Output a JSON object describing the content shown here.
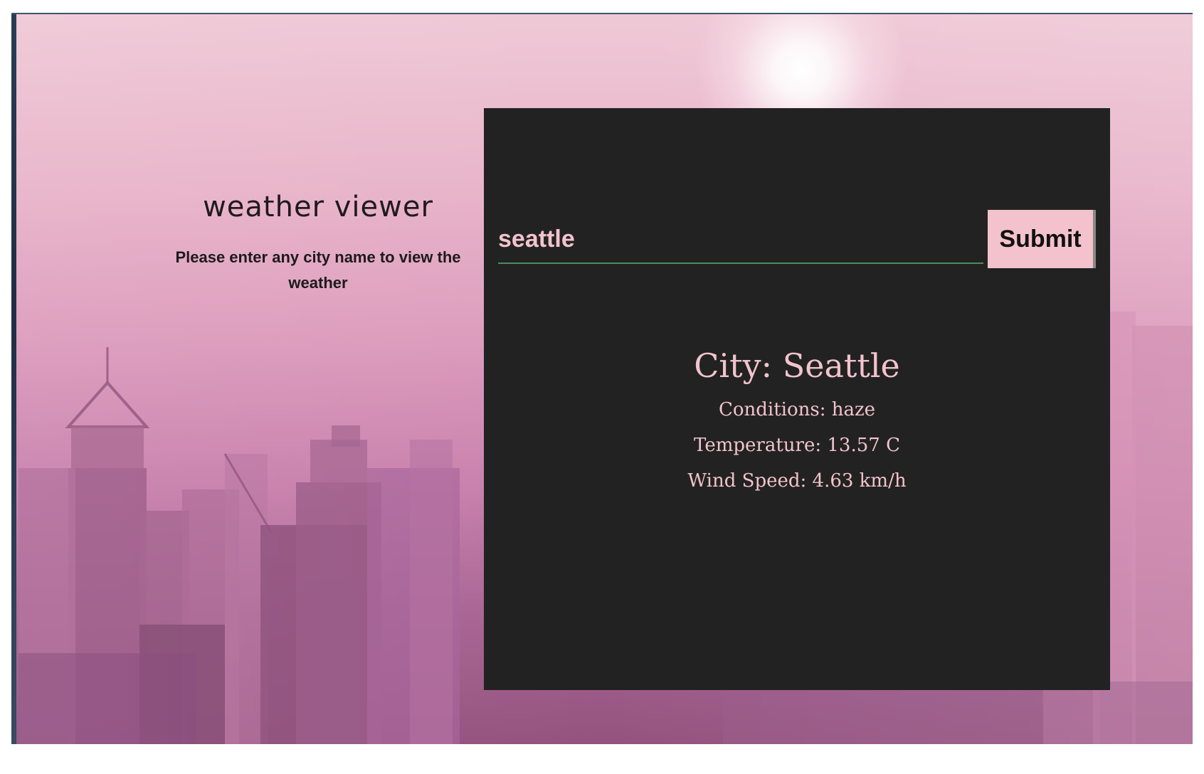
{
  "app": {
    "title": "weather viewer",
    "description": "Please enter any city name to view the weather"
  },
  "search": {
    "value": "seattle",
    "submit_label": "Submit"
  },
  "result": {
    "city": "City: Seattle",
    "conditions": "Conditions: haze",
    "temperature": "Temperature: 13.57 C",
    "wind": "Wind Speed: 4.63 km/h"
  },
  "colors": {
    "card_background": "#222222",
    "accent_pink": "#f4c2cc",
    "result_text": "#f2c3cf",
    "input_underline": "#4e8a5d"
  }
}
